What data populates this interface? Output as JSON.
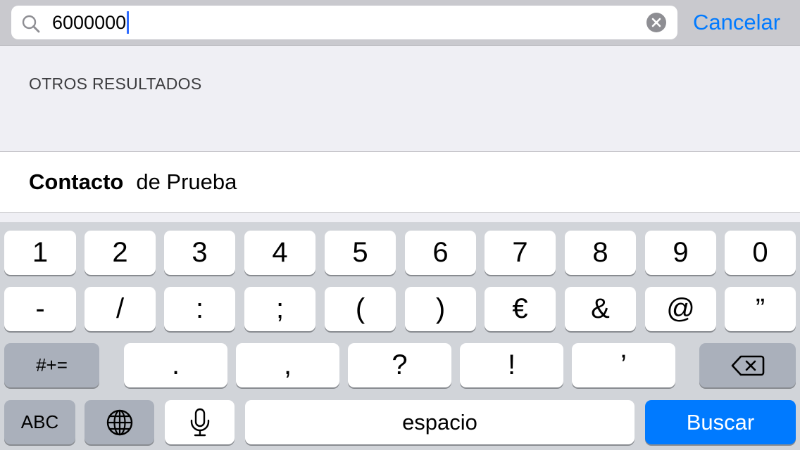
{
  "search": {
    "value": "6000000",
    "cancel_label": "Cancelar"
  },
  "results": {
    "section_header": "OTROS RESULTADOS",
    "items": [
      {
        "bold": "Contacto",
        "rest": "de Prueba"
      }
    ]
  },
  "keyboard": {
    "row1": [
      "1",
      "2",
      "3",
      "4",
      "5",
      "6",
      "7",
      "8",
      "9",
      "0"
    ],
    "row2": [
      "-",
      "/",
      ":",
      ";",
      "(",
      ")",
      "€",
      "&",
      "@",
      "”"
    ],
    "row3": {
      "toggle": "#+=",
      "keys": [
        ".",
        ",",
        "?",
        "!",
        "’"
      ],
      "delete_icon": "backspace-icon"
    },
    "row4": {
      "abc": "ABC",
      "globe_icon": "globe-icon",
      "mic_icon": "microphone-icon",
      "space": "espacio",
      "action": "Buscar"
    }
  },
  "colors": {
    "accent": "#007aff",
    "search_bar_bg": "#c9c9ce",
    "keyboard_bg": "#d1d4d9",
    "dark_key": "#aab0bb"
  }
}
